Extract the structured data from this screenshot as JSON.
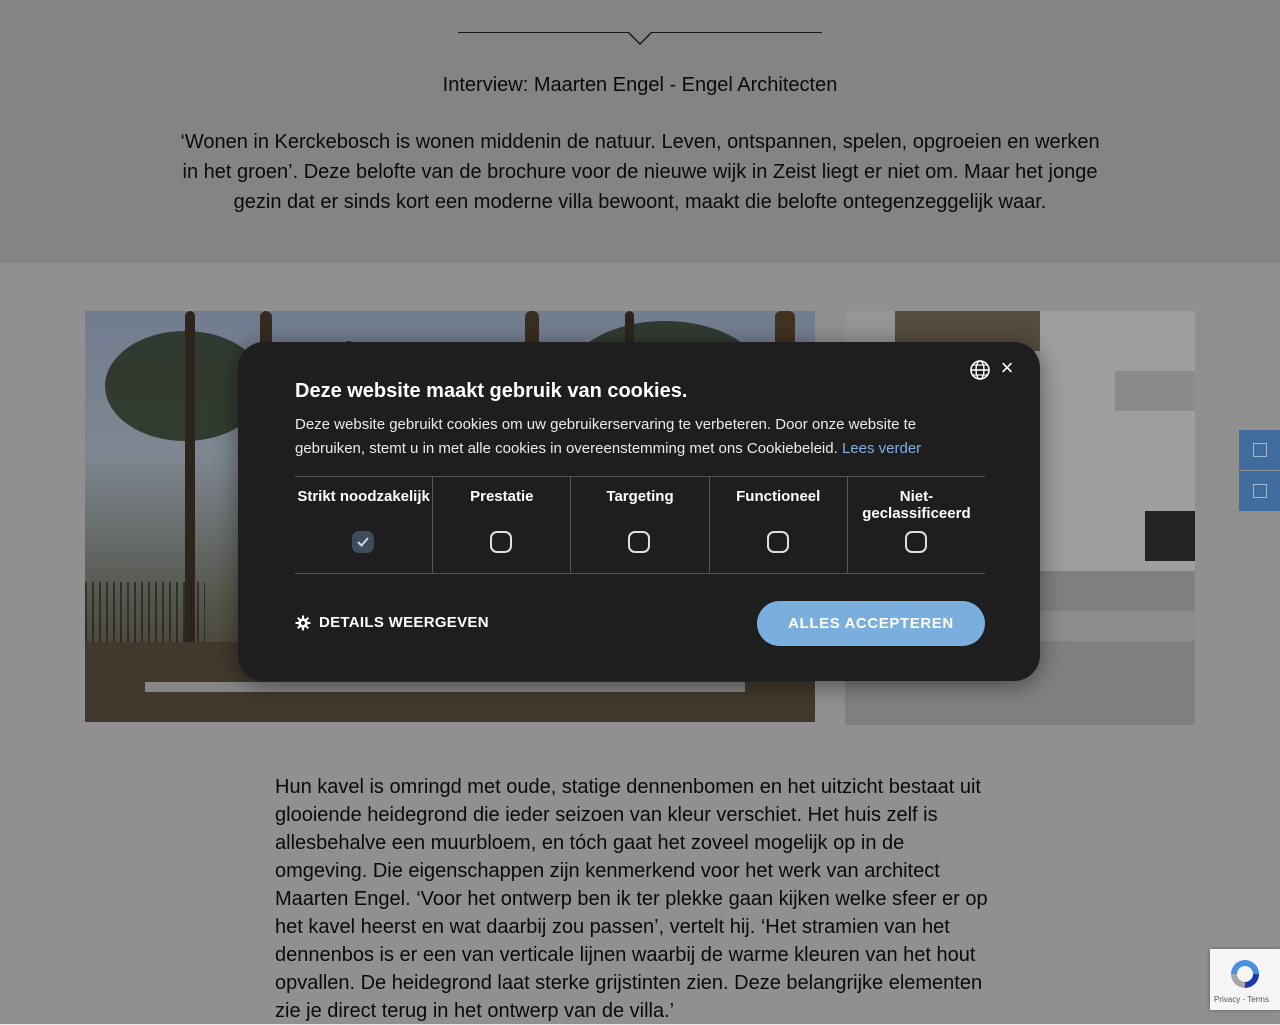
{
  "article": {
    "interview_title": "Interview: Maarten Engel - Engel Architecten",
    "intro": "‘Wonen in Kerckebosch is wonen middenin de natuur. Leven, ontspannen, spelen, opgroeien en werken in het groen’. Deze belofte van de brochure voor de nieuwe wijk in Zeist liegt er niet om. Maar het jonge gezin dat er sinds kort een moderne villa bewoont, maakt die belofte ontegenzeggelijk waar.",
    "body": "Hun kavel is omringd met oude, statige dennenbomen en het uitzicht bestaat uit glooiende heidegrond die ieder seizoen van kleur verschiet. Het huis zelf is allesbehalve een muurbloem, en tóch gaat het zoveel mogelijk op in de omgeving. Die eigenschappen zijn kenmerkend voor het werk van architect Maarten Engel. ‘Voor het ontwerp ben ik ter plekke gaan kijken welke sfeer er op het kavel heerst en wat daarbij zou passen’, vertelt hij. ‘Het stramien van het dennenbos is er een van verticale lijnen waarbij de warme kleuren van het hout opvallen. De heidegrond laat sterke grijstinten zien. Deze belangrijke elementen zie je direct terug in het ontwerp van de villa.’"
  },
  "cookie": {
    "title": "Deze website maakt gebruik van cookies.",
    "description": "Deze website gebruikt cookies om uw gebruikerservaring te verbeteren. Door onze website te gebruiken, stemt u in met alle cookies in overeenstemming met ons Cookiebeleid.",
    "read_more": "Lees verder",
    "close_symbol": "×",
    "categories": [
      {
        "label": "Strikt noodzakelijk",
        "checked": true
      },
      {
        "label": "Prestatie",
        "checked": false
      },
      {
        "label": "Targeting",
        "checked": false
      },
      {
        "label": "Functioneel",
        "checked": false
      },
      {
        "label": "Niet-geclassificeerd",
        "checked": false
      }
    ],
    "details_label": "DETAILS WEERGEVEN",
    "accept_label": "ALLES ACCEPTEREN"
  },
  "recaptcha": {
    "links": "Privacy - Terms"
  },
  "icons": {
    "language": "globe-icon",
    "close": "close-icon",
    "details": "gear-icon",
    "recaptcha": "recaptcha-icon"
  },
  "colors": {
    "dialog_bg": "#1e1e1e",
    "accept_button": "#7aaedc",
    "link": "#7fb0e6",
    "side_button": "#3f6c9d"
  }
}
